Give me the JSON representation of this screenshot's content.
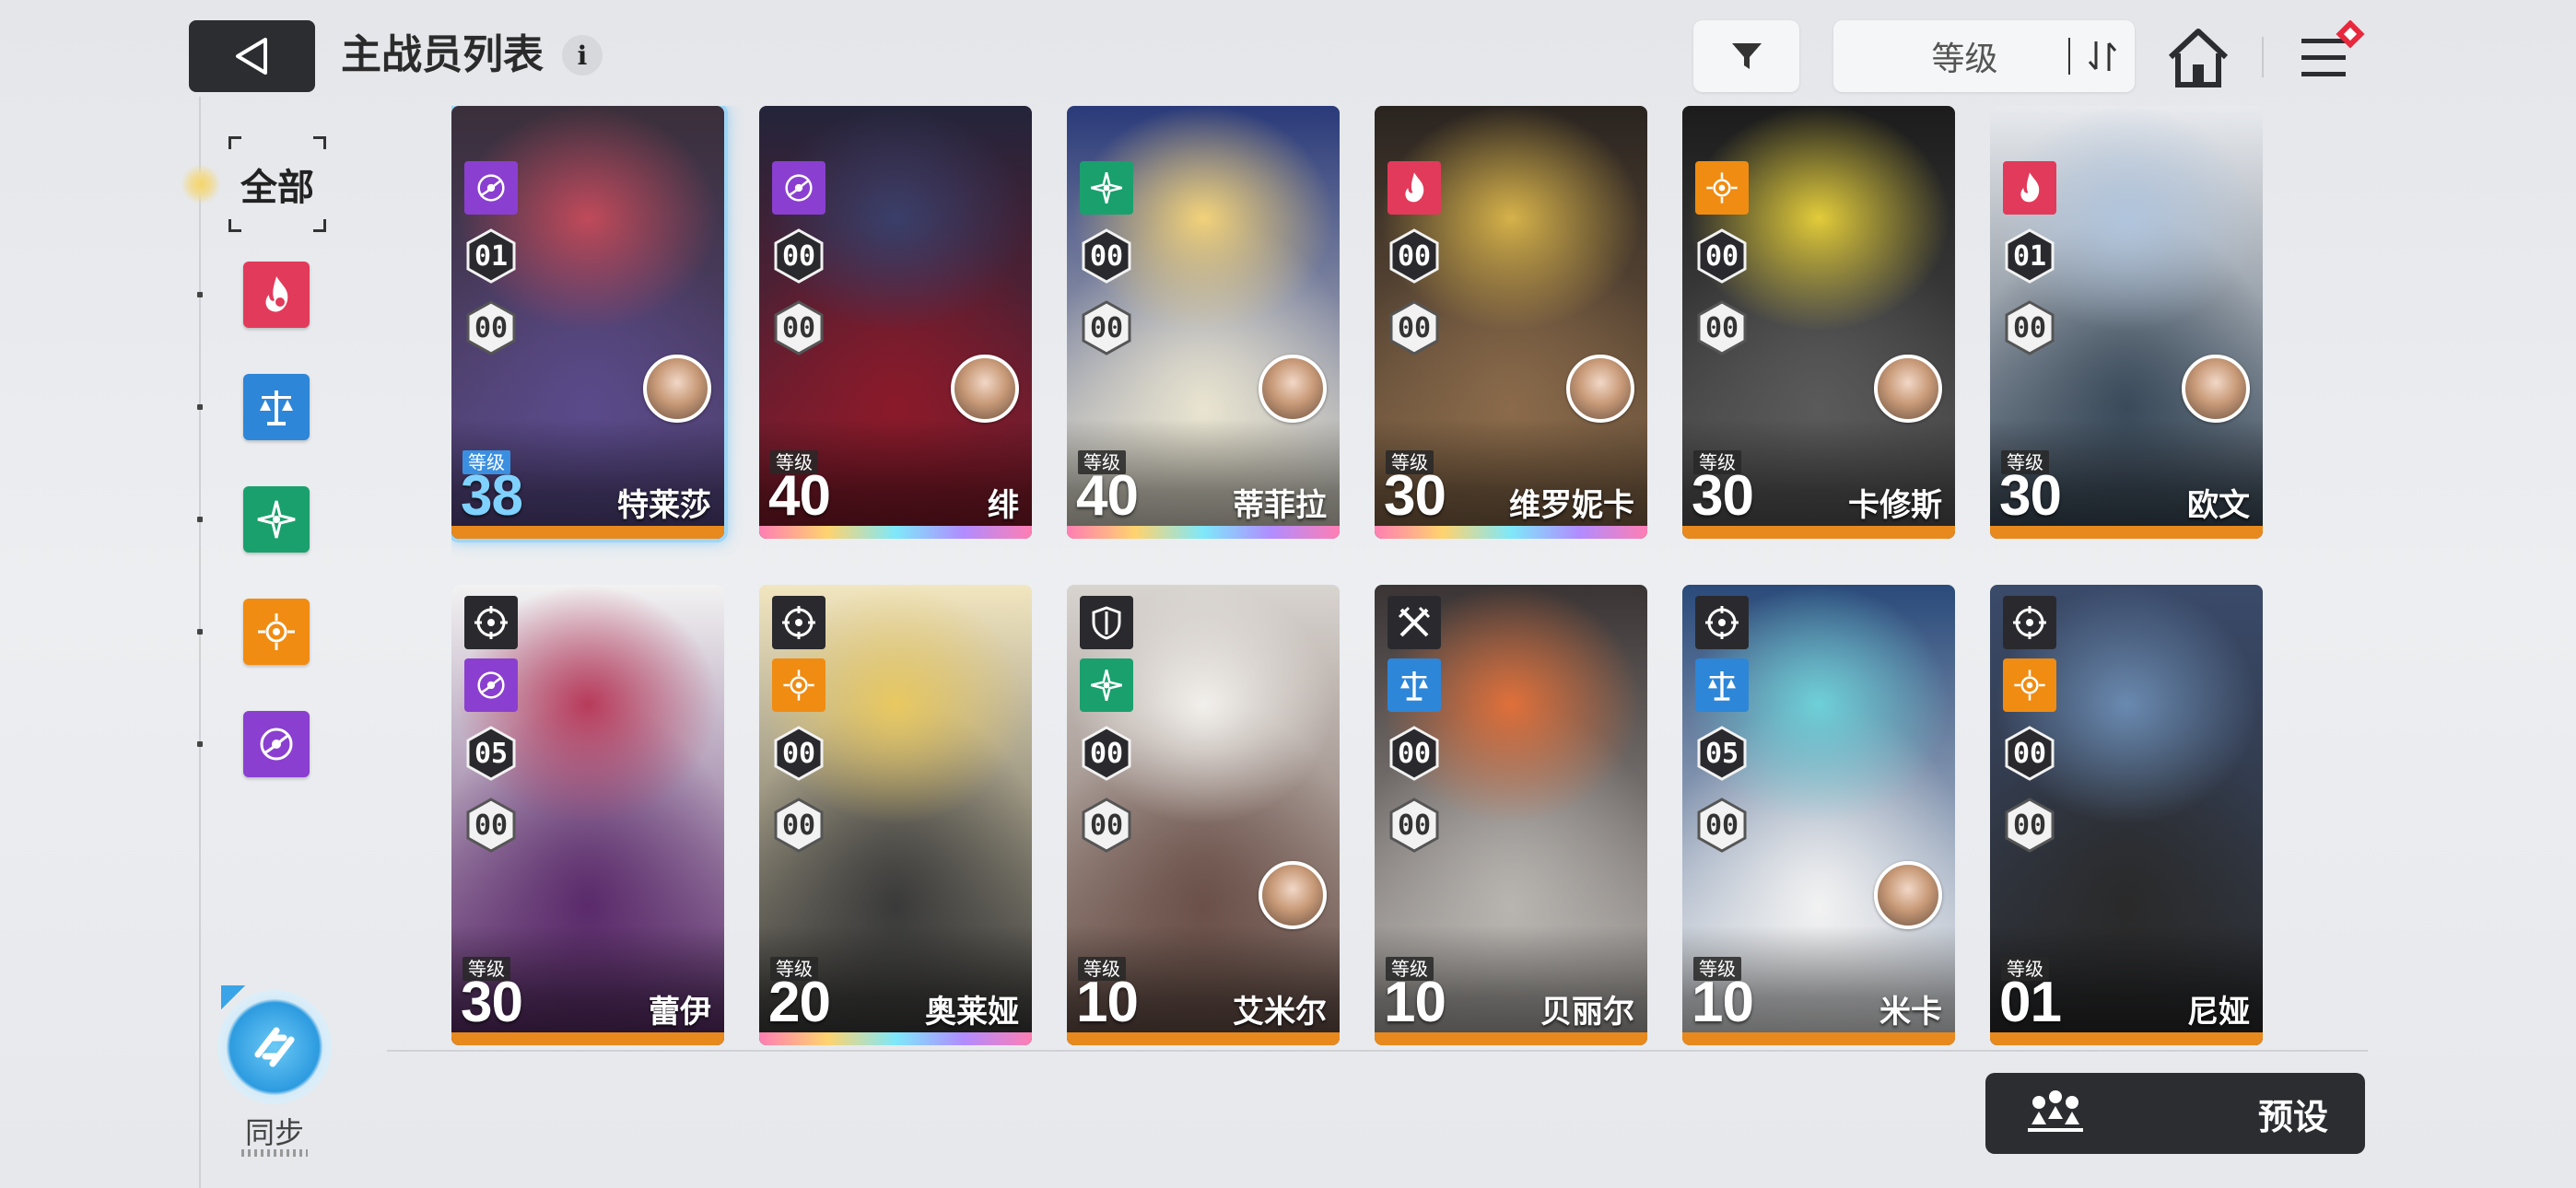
{
  "header": {
    "title": "主战员列表",
    "info_glyph": "i",
    "sort_label": "等级"
  },
  "sidebar": {
    "all_label": "全部",
    "filters": [
      {
        "name": "fire",
        "color": "#e23a5a"
      },
      {
        "name": "scale",
        "color": "#2d86d8"
      },
      {
        "name": "wind",
        "color": "#1aa06d"
      },
      {
        "name": "sun",
        "color": "#f08c12"
      },
      {
        "name": "void",
        "color": "#8a3fd0"
      }
    ],
    "sync_label": "同步"
  },
  "colors": {
    "fire": "#e23a5a",
    "scale": "#2d86d8",
    "wind": "#1aa06d",
    "sun": "#f08c12",
    "void": "#8a3fd0",
    "orange_bar": "#e8891d",
    "rainbow_bar": "linear-gradient(90deg,#ff7eb3,#ffd36e,#7ee8fa,#b18cff,#ff7eb3)"
  },
  "level_label": "等级",
  "cards": [
    {
      "name": "特莱莎",
      "level": "38",
      "rank": "01",
      "sub": "00",
      "class": "sniper",
      "element": "void",
      "rarity": "orange",
      "selected": true,
      "has_avatar": true
    },
    {
      "name": "绯",
      "level": "40",
      "rank": "00",
      "sub": "00",
      "class": "blade",
      "element": "void",
      "rarity": "rainbow",
      "selected": false,
      "has_avatar": true
    },
    {
      "name": "蒂菲拉",
      "level": "40",
      "rank": "00",
      "sub": "00",
      "class": "shield",
      "element": "wind",
      "rarity": "rainbow",
      "selected": false,
      "has_avatar": true
    },
    {
      "name": "维罗妮卡",
      "level": "30",
      "rank": "00",
      "sub": "00",
      "class": "blade",
      "element": "fire",
      "rarity": "rainbow",
      "selected": false,
      "has_avatar": true
    },
    {
      "name": "卡修斯",
      "level": "30",
      "rank": "00",
      "sub": "00",
      "class": "sniper",
      "element": "sun",
      "rarity": "orange",
      "selected": false,
      "has_avatar": true
    },
    {
      "name": "欧文",
      "level": "30",
      "rank": "01",
      "sub": "00",
      "class": "blade",
      "element": "fire",
      "rarity": "orange",
      "selected": false,
      "has_avatar": true
    },
    {
      "name": "蕾伊",
      "level": "30",
      "rank": "05",
      "sub": "00",
      "class": "sniper",
      "element": "void",
      "rarity": "orange",
      "selected": false,
      "has_avatar": false
    },
    {
      "name": "奥莱娅",
      "level": "20",
      "rank": "00",
      "sub": "00",
      "class": "sniper",
      "element": "sun",
      "rarity": "rainbow",
      "selected": false,
      "has_avatar": false
    },
    {
      "name": "艾米尔",
      "level": "10",
      "rank": "00",
      "sub": "00",
      "class": "shield",
      "element": "wind",
      "rarity": "orange",
      "selected": false,
      "has_avatar": true
    },
    {
      "name": "贝丽尔",
      "level": "10",
      "rank": "00",
      "sub": "00",
      "class": "blade",
      "element": "scale",
      "rarity": "orange",
      "selected": false,
      "has_avatar": false
    },
    {
      "name": "米卡",
      "level": "10",
      "rank": "05",
      "sub": "00",
      "class": "sniper",
      "element": "scale",
      "rarity": "orange",
      "selected": false,
      "has_avatar": true
    },
    {
      "name": "尼娅",
      "level": "01",
      "rank": "00",
      "sub": "00",
      "class": "sniper",
      "element": "sun",
      "rarity": "orange",
      "selected": false,
      "has_avatar": false
    }
  ],
  "preset_label": "预设"
}
